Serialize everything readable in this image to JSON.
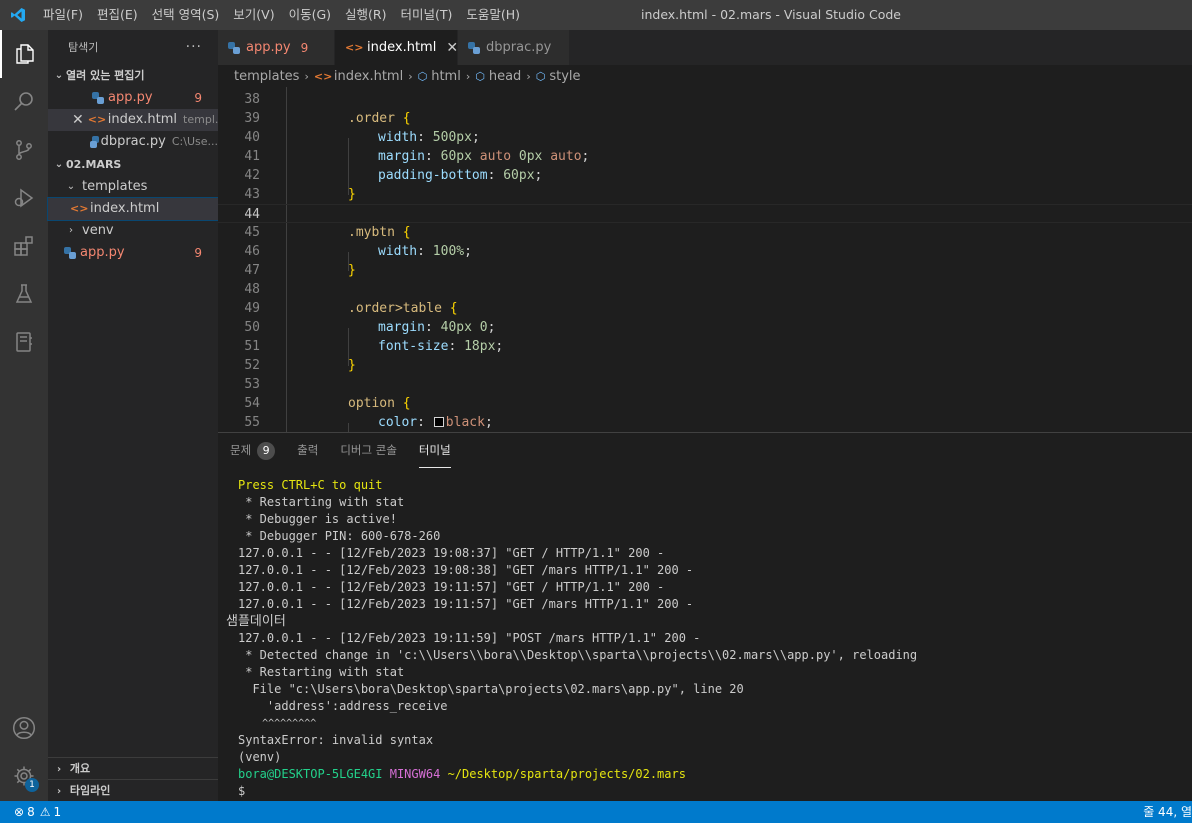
{
  "window": {
    "title": "index.html - 02.mars - Visual Studio Code"
  },
  "menu": [
    "파일(F)",
    "편집(E)",
    "선택 영역(S)",
    "보기(V)",
    "이동(G)",
    "실행(R)",
    "터미널(T)",
    "도움말(H)"
  ],
  "sidebar": {
    "title": "탐색기",
    "more": "···",
    "open_editors_label": "열려 있는 편집기",
    "open_editors": [
      {
        "name": "app.py",
        "count": "9"
      },
      {
        "name": "index.html",
        "path": "templ..."
      },
      {
        "name": "dbprac.py",
        "path": "C:\\Use..."
      }
    ],
    "folder_label": "02.MARS",
    "tree": {
      "templates": "templates",
      "index": "index.html",
      "venv": "venv",
      "app": "app.py",
      "app_count": "9"
    },
    "outline_label": "개요",
    "timeline_label": "타임라인"
  },
  "activity": {
    "settings_badge": "1"
  },
  "tabs": [
    {
      "name": "app.py",
      "count": "9"
    },
    {
      "name": "index.html"
    },
    {
      "name": "dbprac.py"
    }
  ],
  "breadcrumb": [
    "templates",
    "index.html",
    "html",
    "head",
    "style"
  ],
  "editor": {
    "line_numbers": [
      "38",
      "39",
      "40",
      "41",
      "42",
      "43",
      "44",
      "45",
      "46",
      "47",
      "48",
      "49",
      "50",
      "51",
      "52",
      "53",
      "54",
      "55"
    ],
    "code": {
      "l39_sel": ".order",
      "l40_prop": "width",
      "l40_val": "500px",
      "l41_prop": "margin",
      "l41_v1": "60px",
      "l41_v2": "auto",
      "l41_v3": "0px",
      "l41_v4": "auto",
      "l42_prop": "padding-bottom",
      "l42_val": "60px",
      "l45_sel": ".mybtn",
      "l46_prop": "width",
      "l46_val": "100%",
      "l49_sel": ".order>table",
      "l50_prop": "margin",
      "l50_v1": "40px",
      "l50_v2": "0",
      "l51_prop": "font-size",
      "l51_val": "18px",
      "l54_sel": "option",
      "l55_prop": "color",
      "l55_val": "black"
    }
  },
  "panel": {
    "tabs": [
      "문제",
      "출력",
      "디버그 콘솔",
      "터미널"
    ],
    "problems_count": "9",
    "terminal": {
      "l1": "Press CTRL+C to quit",
      "l2": " * Restarting with stat",
      "l3": " * Debugger is active!",
      "l4": " * Debugger PIN: 600-678-260",
      "l5": "127.0.0.1 - - [12/Feb/2023 19:08:37] \"GET / HTTP/1.1\" 200 -",
      "l6": "127.0.0.1 - - [12/Feb/2023 19:08:38] \"GET /mars HTTP/1.1\" 200 -",
      "l7": "127.0.0.1 - - [12/Feb/2023 19:11:57] \"GET / HTTP/1.1\" 200 -",
      "l8": "127.0.0.1 - - [12/Feb/2023 19:11:57] \"GET /mars HTTP/1.1\" 200 -",
      "l9": "샘플데이터",
      "l10": "127.0.0.1 - - [12/Feb/2023 19:11:59] \"POST /mars HTTP/1.1\" 200 -",
      "l11": " * Detected change in 'c:\\\\Users\\\\bora\\\\Desktop\\\\sparta\\\\projects\\\\02.mars\\\\app.py', reloading",
      "l12": " * Restarting with stat",
      "l13": "  File \"c:\\Users\\bora\\Desktop\\sparta\\projects\\02.mars\\app.py\", line 20",
      "l14": "    'address':address_receive",
      "l15": "    ^^^^^^^^^",
      "l16": "SyntaxError: invalid syntax",
      "l17": "(venv)",
      "prompt_user": "bora@DESKTOP-5LGE4GI",
      "prompt_env": "MINGW64",
      "prompt_path": "~/Desktop/sparta/projects/02.mars",
      "prompt_symbol": "$"
    }
  },
  "status": {
    "errors": "8",
    "warnings": "1",
    "position": "줄 44, 열"
  }
}
